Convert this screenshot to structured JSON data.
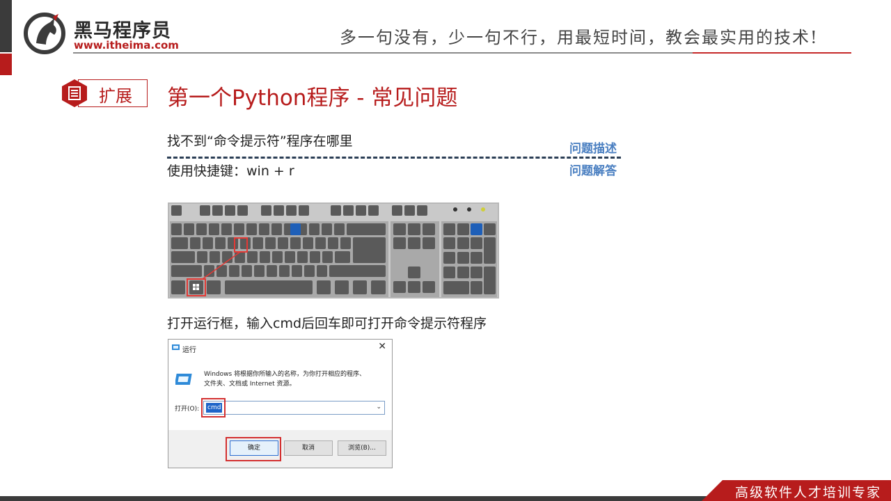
{
  "header": {
    "brand_name": "黑马程序员",
    "brand_url": "www.itheima.com",
    "slogan": "多一句没有，少一句不行，用最短时间，教会最实用的技术!"
  },
  "section": {
    "tag": "扩展",
    "title": "第一个Python程序 - 常见问题"
  },
  "qa": {
    "question": "找不到“命令提示符”程序在哪里",
    "answer": "使用快捷键：win + r",
    "question_tag": "问题描述",
    "answer_tag": "问题解答"
  },
  "step2": "打开运行框，输入cmd后回车即可打开命令提示符程序",
  "run_dialog": {
    "title": "运行",
    "close": "✕",
    "desc_line1": "Windows 将根据你所输入的名称，为你打开相应的程序、",
    "desc_line2": "文件夹、文档或 Internet 资源。",
    "open_label": "打开(O):",
    "input_value": "cmd",
    "ok": "确定",
    "cancel": "取消",
    "browse": "浏览(B)..."
  },
  "footer": {
    "text": "高级软件人才培训专家"
  },
  "colors": {
    "brand_red": "#b71c1c",
    "tag_blue": "#4a7fc1"
  }
}
